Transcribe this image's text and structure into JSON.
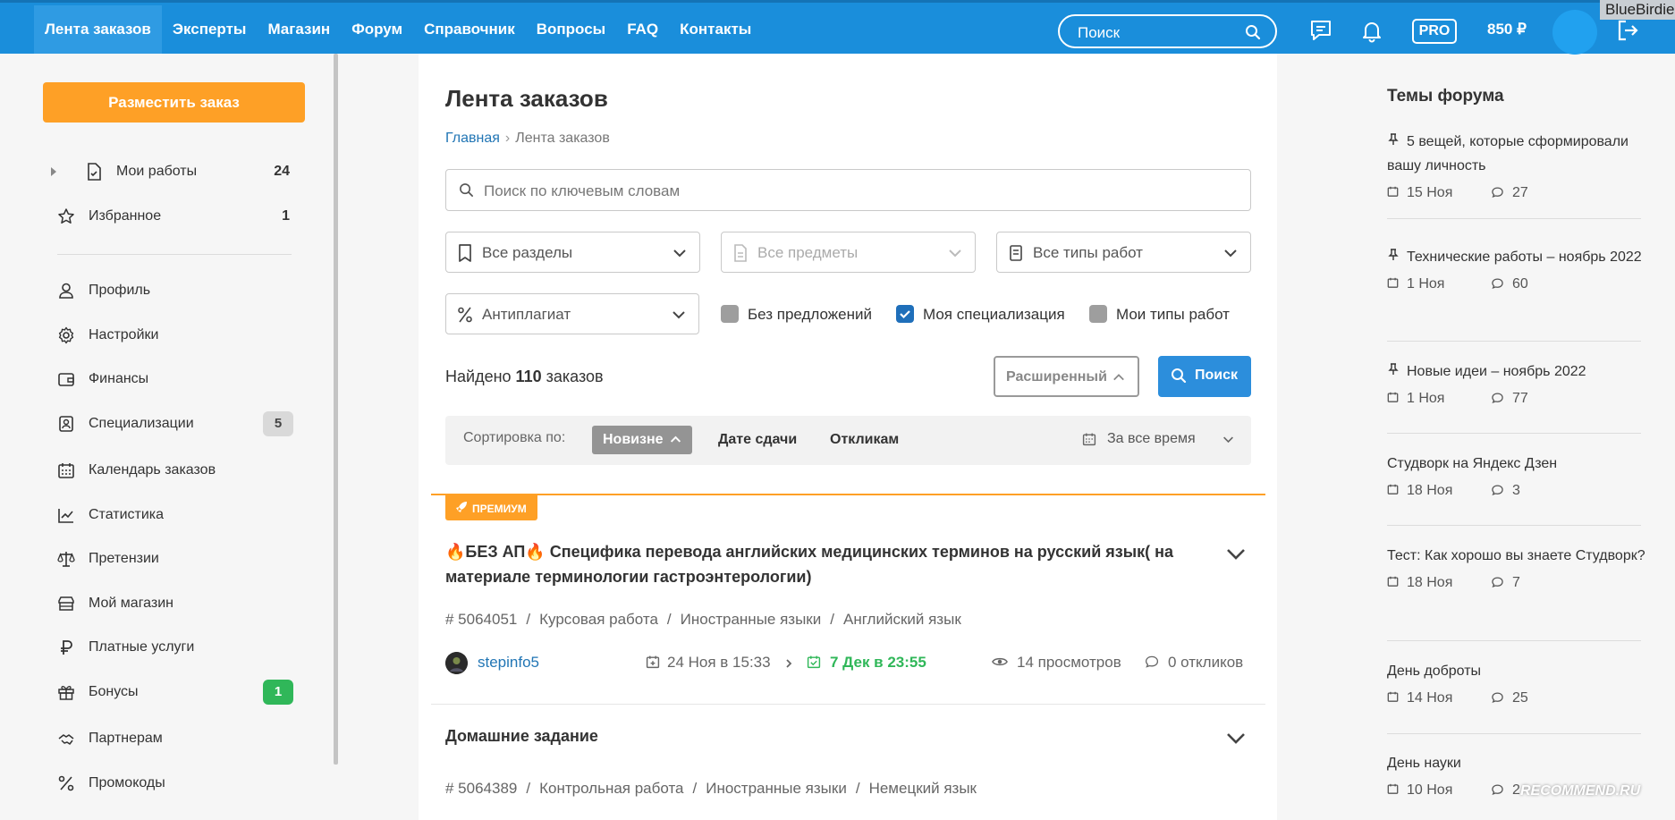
{
  "topnav": {
    "items": [
      {
        "label": "Лента заказов",
        "active": true
      },
      {
        "label": "Эксперты"
      },
      {
        "label": "Магазин"
      },
      {
        "label": "Форум"
      },
      {
        "label": "Справочник"
      },
      {
        "label": "Вопросы"
      },
      {
        "label": "FAQ"
      },
      {
        "label": "Контакты"
      }
    ],
    "search_placeholder": "Поиск",
    "pro_label": "PRO",
    "balance": "850 ₽",
    "watermark": "BlueBirdie",
    "accent_color": "#1a8edb"
  },
  "sidebar": {
    "post_button": "Разместить заказ",
    "items": [
      {
        "label": "Мои работы",
        "count": "24",
        "icon": "file-check-icon"
      },
      {
        "label": "Избранное",
        "count": "1",
        "icon": "star-icon"
      },
      {
        "label": "Профиль",
        "icon": "user-icon"
      },
      {
        "label": "Настройки",
        "icon": "gear-icon"
      },
      {
        "label": "Финансы",
        "icon": "wallet-icon"
      },
      {
        "label": "Специализации",
        "badge": "5",
        "icon": "id-card-icon"
      },
      {
        "label": "Календарь заказов",
        "icon": "calendar-icon"
      },
      {
        "label": "Статистика",
        "icon": "chart-line-icon"
      },
      {
        "label": "Претензии",
        "icon": "scales-icon"
      },
      {
        "label": "Мой магазин",
        "icon": "store-icon"
      },
      {
        "label": "Платные услуги",
        "icon": "ruble-icon"
      },
      {
        "label": "Бонусы",
        "badge": "1",
        "icon": "gift-icon"
      },
      {
        "label": "Партнерам",
        "icon": "handshake-icon"
      },
      {
        "label": "Промокоды",
        "icon": "percent-icon"
      }
    ],
    "button_color": "#fea026",
    "badge_green": "#30b759"
  },
  "main": {
    "title": "Лента заказов",
    "breadcrumb": {
      "home": "Главная",
      "current": "Лента заказов"
    },
    "keyword_placeholder": "Поиск по ключевым словам",
    "filters": {
      "sections": "Все разделы",
      "subjects": "Все предметы",
      "work_types": "Все типы работ",
      "antiplagiat": "Антиплагиат"
    },
    "checkboxes": {
      "no_offers": {
        "label": "Без предложений",
        "checked": false
      },
      "my_spec": {
        "label": "Моя специализация",
        "checked": true
      },
      "my_types": {
        "label": "Мои типы работ",
        "checked": false
      }
    },
    "found_prefix": "Найдено",
    "found_count": "110",
    "found_suffix": "заказов",
    "advanced_button": "Расширенный",
    "search_button": "Поиск",
    "sort": {
      "label": "Сортировка по:",
      "active": "Новизне",
      "options": [
        "Дате сдачи",
        "Откликам"
      ],
      "period": "За все время"
    },
    "orders": [
      {
        "tag": "ПРЕМИУМ",
        "title_line1": "🔥БЕЗ АП🔥 Специфика перевода английских медицинских терминов на русский язык( на",
        "title_line2": "материале терминологии гастроэнтерологии)",
        "id": "# 5064051",
        "type": "Курсовая работа",
        "subject": "Иностранные языки",
        "subsubject": "Английский язык",
        "author": "stepinfo5",
        "created": "24 Ноя в 15:33",
        "deadline": "7 Дек в 23:55",
        "views": "14 просмотров",
        "responses": "0 откликов"
      },
      {
        "title": "Домашние задание",
        "id": "# 5064389",
        "type": "Контрольная работа",
        "subject": "Иностранные языки",
        "subsubject": "Немецкий язык"
      }
    ]
  },
  "forum": {
    "title": "Темы форума",
    "topics": [
      {
        "title": "5 вещей, которые сформировали вашу личность",
        "date": "15 Ноя",
        "comments": "27",
        "pinned": true
      },
      {
        "title": "Технические работы – ноябрь 2022",
        "date": "1 Ноя",
        "comments": "60",
        "pinned": true
      },
      {
        "title": "Новые идеи – ноябрь 2022",
        "date": "1 Ноя",
        "comments": "77",
        "pinned": true
      },
      {
        "title": "Студворк на Яндекс Дзен",
        "date": "18 Ноя",
        "comments": "3"
      },
      {
        "title": "Тест: Как хорошо вы знаете Студворк?",
        "date": "18 Ноя",
        "comments": "7"
      },
      {
        "title": "День доброты",
        "date": "14 Ноя",
        "comments": "25"
      },
      {
        "title": "День науки",
        "date": "10 Ноя",
        "comments": "2"
      }
    ]
  },
  "watermark_bottom": "RECOMMEND.RU"
}
